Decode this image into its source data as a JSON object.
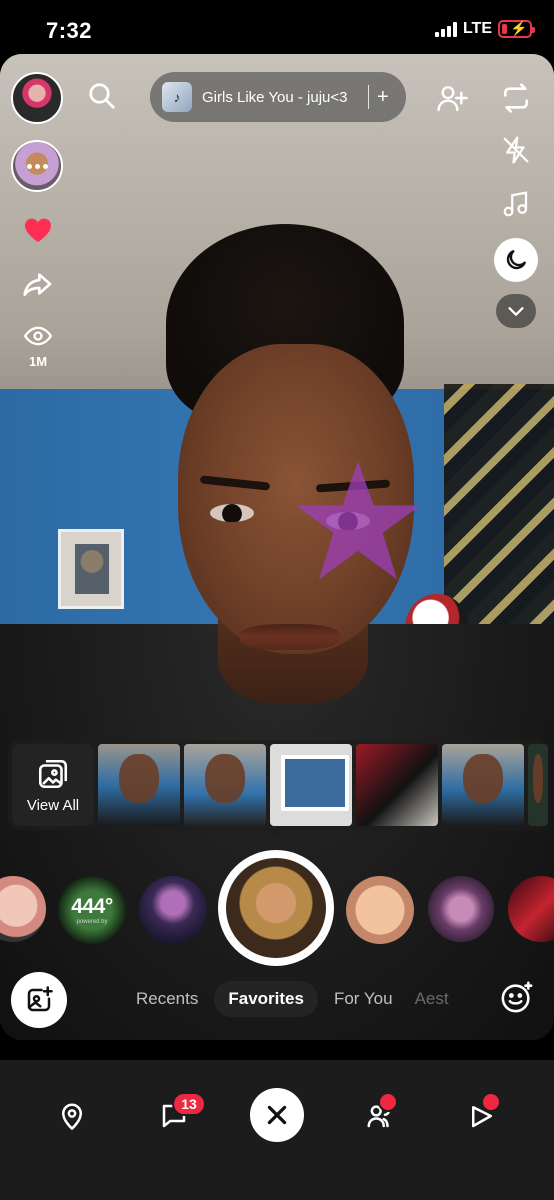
{
  "status_bar": {
    "time": "7:32",
    "network": "LTE"
  },
  "camera": {
    "music": {
      "title": "Girls Like You - juju<3",
      "add_label": "+"
    },
    "left_rail": {
      "views": "1M"
    },
    "lens_strip": {
      "view_all_label": "View All"
    },
    "lens_carousel": {
      "featured_lens_text": "444°",
      "featured_lens_subtext": "powered by"
    },
    "tabs": [
      {
        "label": "Recents"
      },
      {
        "label": "Favorites"
      },
      {
        "label": "For You"
      },
      {
        "label": "Aest"
      }
    ],
    "active_tab": "Favorites"
  },
  "bottom_nav": {
    "chat_badge": "13"
  },
  "colors": {
    "accent": "#ee2841",
    "sticker": "#9b3fb5",
    "heart": "#ff2e55"
  }
}
